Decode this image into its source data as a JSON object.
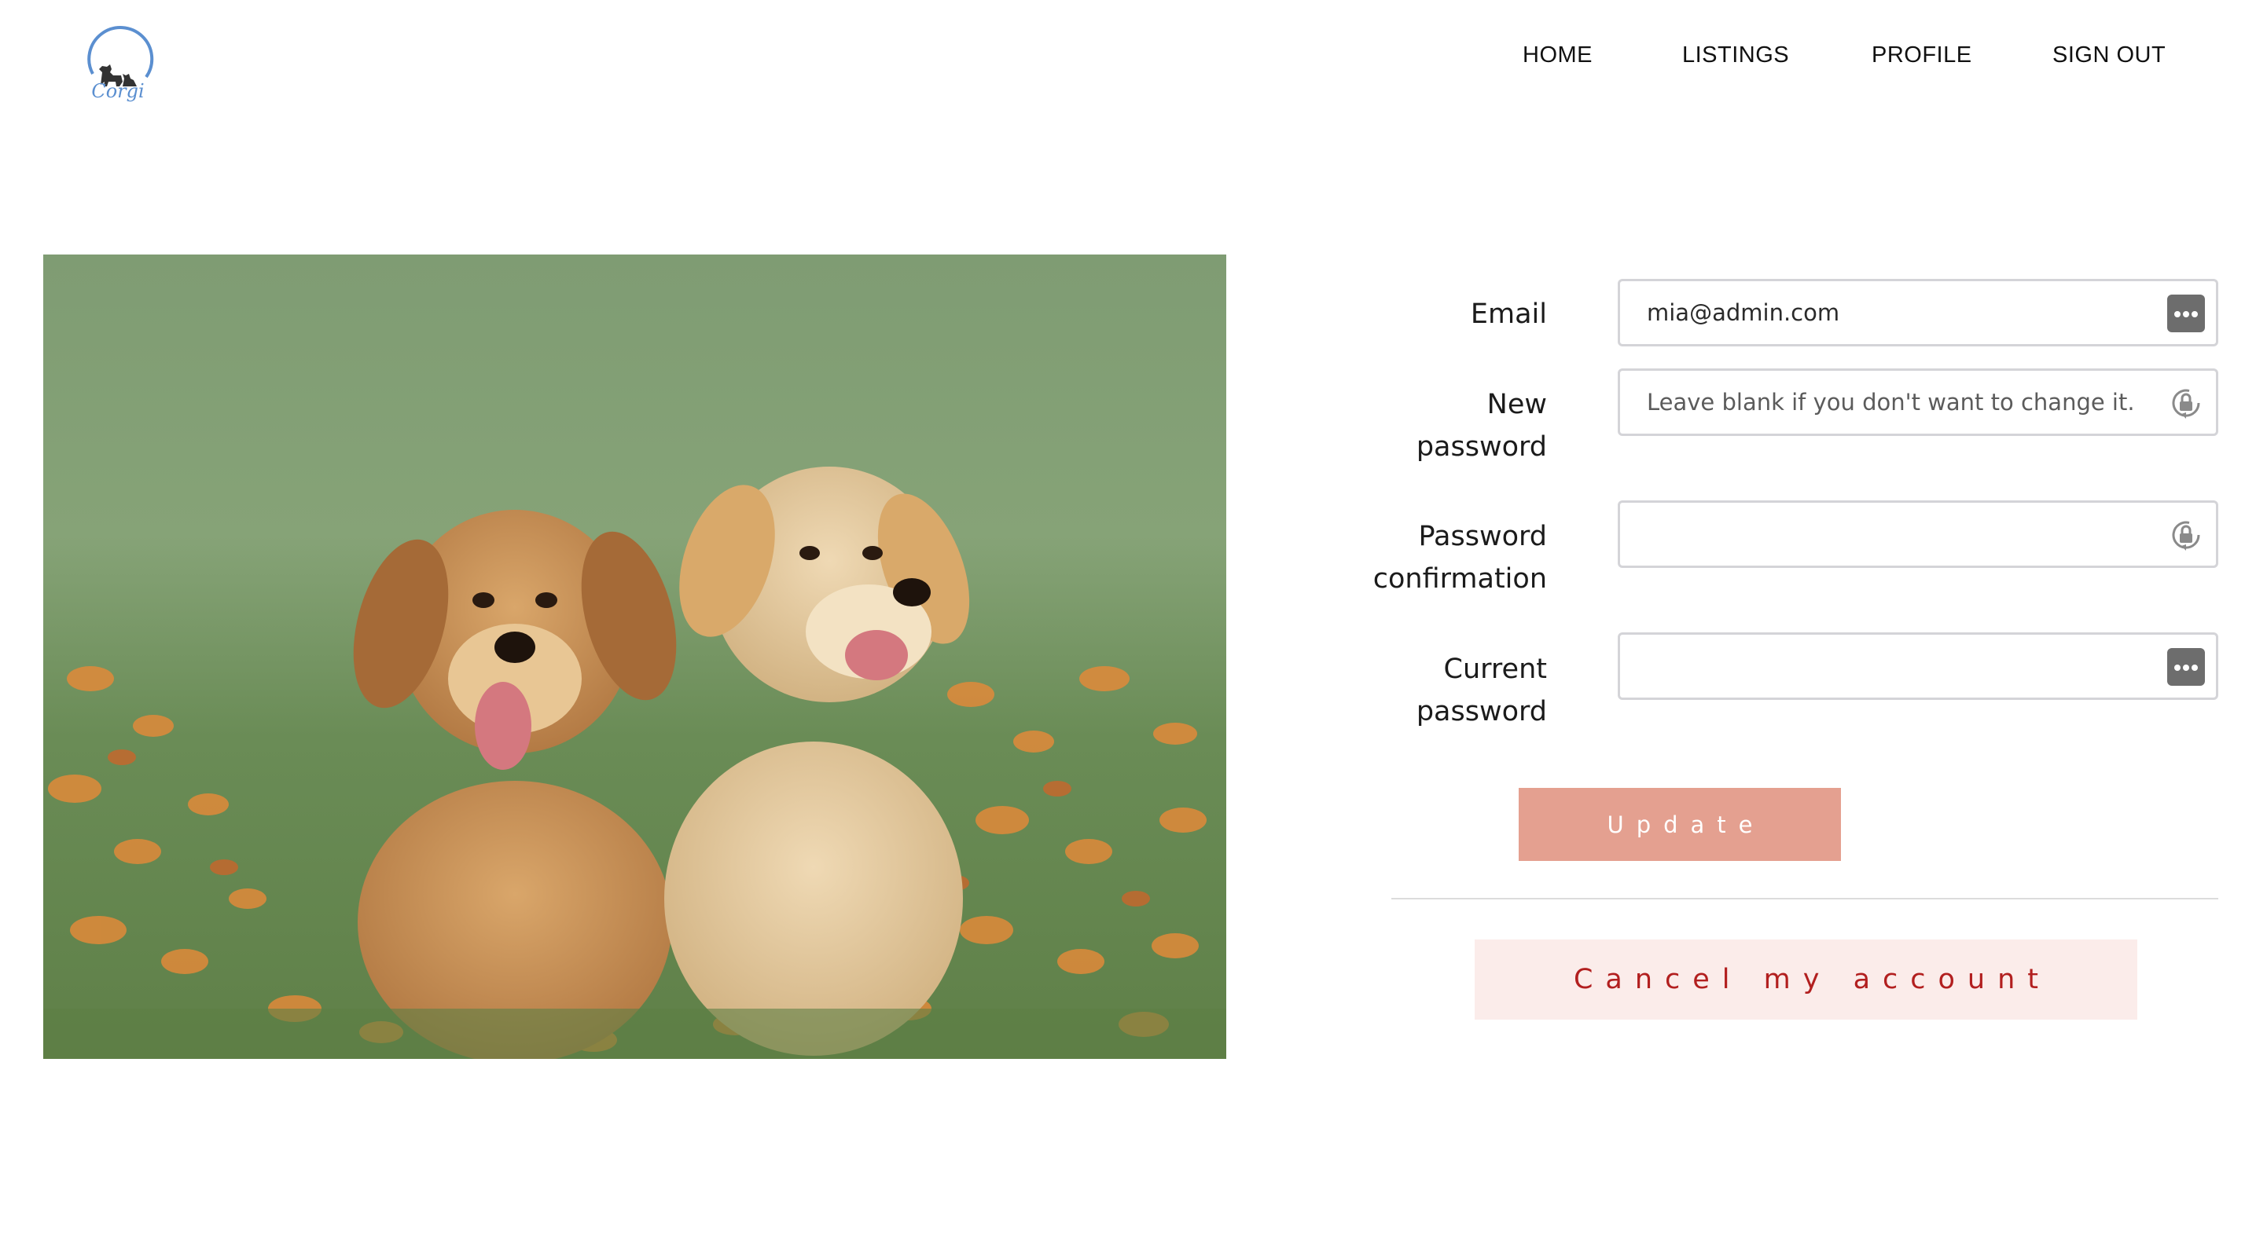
{
  "brand": {
    "logo_text": "Corgi",
    "accent": "#5b8fd0"
  },
  "nav": {
    "items": [
      {
        "label": "HOME"
      },
      {
        "label": "LISTINGS"
      },
      {
        "label": "PROFILE"
      },
      {
        "label": "SIGN OUT"
      }
    ]
  },
  "form": {
    "email": {
      "label": "Email",
      "value": "mia@admin.com",
      "icon": "password-manager-icon"
    },
    "new_password": {
      "label_line1": "New",
      "label_line2": "password",
      "placeholder": "Leave blank if you don't want to change it.",
      "icon": "password-lock-icon"
    },
    "password_confirmation": {
      "label_line1": "Password",
      "label_line2": "confirmation",
      "placeholder": "",
      "icon": "password-lock-icon"
    },
    "current_password": {
      "label_line1": "Current",
      "label_line2": "password",
      "placeholder": "",
      "icon": "password-manager-icon"
    },
    "update_label": "Update",
    "cancel_label": "Cancel my account"
  },
  "colors": {
    "update_button": "#e4a090",
    "cancel_button_bg": "#fbecea",
    "cancel_button_text": "#b21f1f"
  }
}
